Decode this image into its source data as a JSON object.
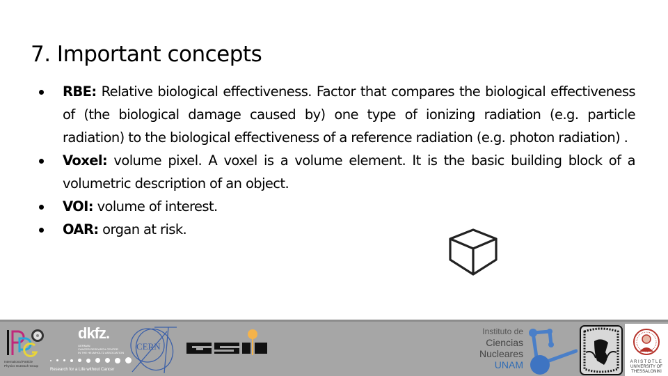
{
  "slide": {
    "title": "7. Important concepts",
    "bullets": [
      {
        "term": "RBE:",
        "text": " Relative biological effectiveness. Factor that compares the biological effectiveness of (the biological damage caused by) one type of ionizing radiation (e.g. particle radiation) to the biological effectiveness of a reference radiation (e.g. photon radiation) ."
      },
      {
        "term": "Voxel:",
        "text": " volume pixel. A voxel is a volume element. It is the basic building block of a volumetric description of an object."
      },
      {
        "term": "VOI:",
        "text": " volume of interest."
      },
      {
        "term": "OAR:",
        "text": " organ at risk."
      }
    ],
    "illustration": "cube-icon"
  },
  "logos": {
    "ippg": {
      "letters": "IPPG",
      "caption_line1": "International Particle",
      "caption_line2": "Physics Outreach Group"
    },
    "dkfz": {
      "wordmark": "dkfz.",
      "sub_line1": "GERMAN",
      "sub_line2": "CANCER RESEARCH CENTER",
      "sub_line3": "IN THE HELMHOLTZ ASSOCIATION",
      "tagline": "Research for a Life without Cancer"
    },
    "cern": {
      "wordmark": "CERN"
    },
    "gsi": {
      "wordmark": "GSI"
    },
    "icn": {
      "line1": "Instituto de",
      "line2": "Ciencias",
      "line3": "Nucleares",
      "line4": "UNAM"
    },
    "unam_seal": {
      "name": "unam-seal"
    },
    "auth": {
      "line1": "ARISTOTLE",
      "line2": "UNIVERSITY OF",
      "line3": "THESSALONIKI"
    }
  },
  "colors": {
    "strip_background": "#a6a6a6",
    "strip_border": "#8c8c8c",
    "cern_blue": "#3b5fa8",
    "gsi_orange": "#f5b34a",
    "unam_blue": "#2e6bb5",
    "auth_red": "#b5322a"
  }
}
